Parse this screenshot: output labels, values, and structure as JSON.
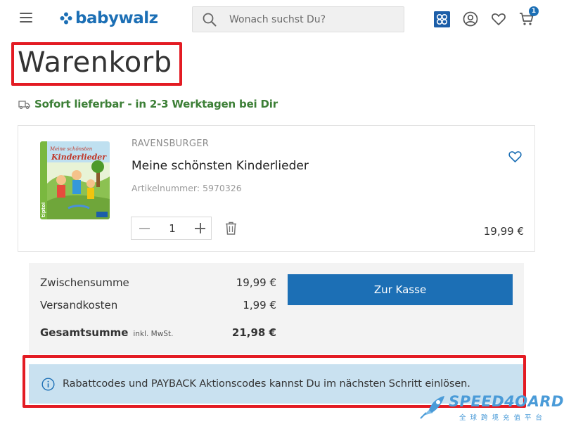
{
  "header": {
    "logo_text": "babywalz",
    "search": {
      "placeholder": "Wonach suchst Du?"
    },
    "cart_count": "1",
    "brand_color": "#1c6fb5"
  },
  "page": {
    "title": "Warenkorb",
    "delivery_text": "Sofort lieferbar - in 2-3 Werktagen bei Dir"
  },
  "cart": {
    "items": [
      {
        "brand": "RAVENSBURGER",
        "name": "Meine schönsten Kinderlieder",
        "article_number": "Artikelnummer: 5970326",
        "quantity": "1",
        "price": "19,99 €",
        "cover_title_line1": "Meine schönsten",
        "cover_title_line2": "Kinderlieder",
        "cover_logo": "tiptoi"
      }
    ]
  },
  "summary": {
    "subtotal_label": "Zwischensumme",
    "subtotal_value": "19,99 €",
    "shipping_label": "Versandkosten",
    "shipping_value": "1,99 €",
    "total_label": "Gesamtsumme",
    "total_note": "inkl. MwSt.",
    "total_value": "21,98 €",
    "checkout_label": "Zur Kasse"
  },
  "info": {
    "text": "Rabattcodes und PAYBACK Aktionscodes kannst Du im nächsten Schritt einlösen."
  },
  "watermark": {
    "brand": "SPEED4OARD",
    "tagline": "全球跨境充值平台"
  },
  "icons": {
    "menu": "hamburger-icon",
    "search": "search-icon",
    "app": "app-grid-icon",
    "account": "account-icon",
    "wishlist": "heart-icon",
    "cart": "cart-icon",
    "delivery": "truck-icon",
    "delete": "trash-icon",
    "info": "info-icon"
  }
}
